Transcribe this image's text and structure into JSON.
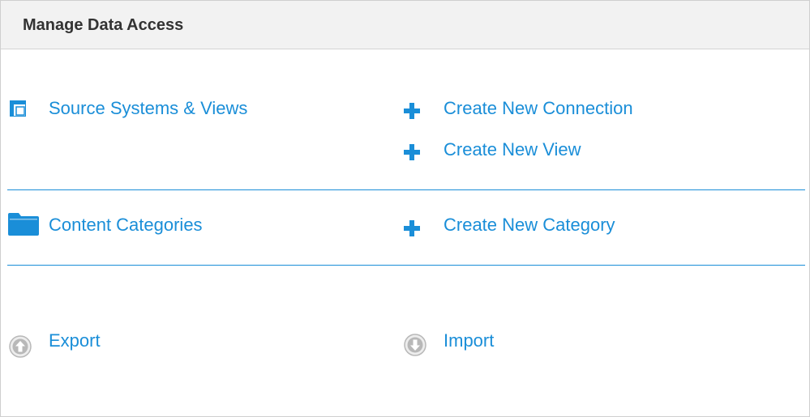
{
  "panel": {
    "title": "Manage Data Access"
  },
  "sections": {
    "source_systems": {
      "label": "Source Systems & Views",
      "icon": "window-stack-icon"
    },
    "create_connection": {
      "label": "Create New Connection",
      "icon": "plus-icon"
    },
    "create_view": {
      "label": "Create New View",
      "icon": "plus-icon"
    },
    "content_categories": {
      "label": "Content Categories",
      "icon": "folder-icon"
    },
    "create_category": {
      "label": "Create New Category",
      "icon": "plus-icon"
    },
    "export": {
      "label": "Export",
      "icon": "arrow-up-circle-icon"
    },
    "import": {
      "label": "Import",
      "icon": "arrow-down-circle-icon"
    }
  },
  "colors": {
    "link": "#1a8ed8",
    "header_bg": "#f2f2f2",
    "divider": "#1a8ed8",
    "disabled_icon": "#b8b8b8"
  }
}
